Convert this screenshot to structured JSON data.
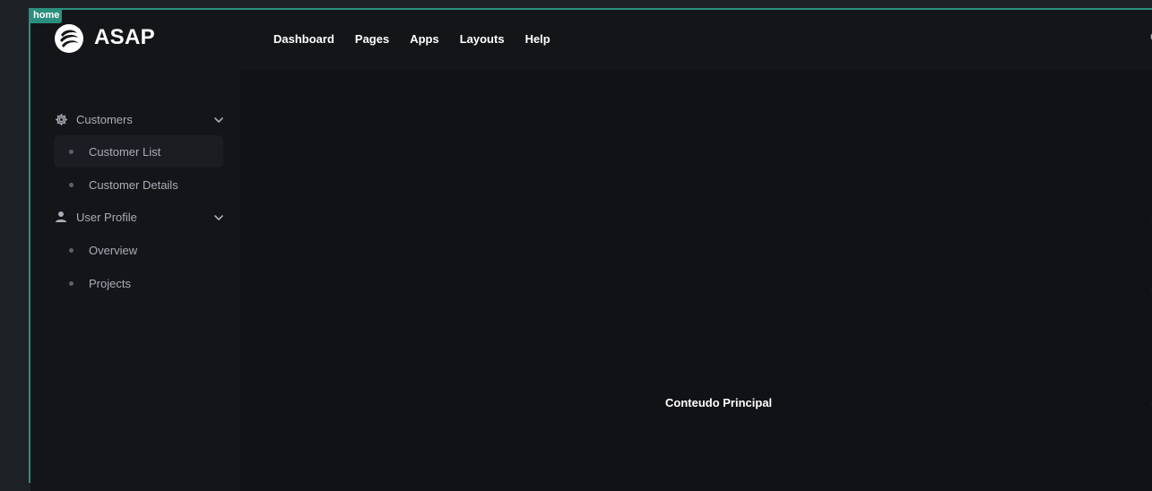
{
  "frame": {
    "tag": "home"
  },
  "header": {
    "brand": "ASAP",
    "logo_icon": "swirl-logo-icon",
    "nav": [
      {
        "label": "Dashboard"
      },
      {
        "label": "Pages"
      },
      {
        "label": "Apps"
      },
      {
        "label": "Layouts"
      },
      {
        "label": "Help"
      }
    ]
  },
  "sidebar": {
    "groups": [
      {
        "label": "Customers",
        "icon": "gear-icon",
        "items": [
          {
            "label": "Customer List",
            "active": true
          },
          {
            "label": "Customer Details",
            "active": false
          }
        ]
      },
      {
        "label": "User Profile",
        "icon": "user-icon",
        "items": [
          {
            "label": "Overview",
            "active": false
          },
          {
            "label": "Projects",
            "active": false
          }
        ]
      }
    ]
  },
  "main": {
    "text": "Conteudo Principal"
  },
  "colors": {
    "accent": "#2a8f7f",
    "background": "#141518",
    "content_bg": "#111215",
    "active_item_bg": "#1c1d22",
    "muted_text": "#a8adb8"
  }
}
